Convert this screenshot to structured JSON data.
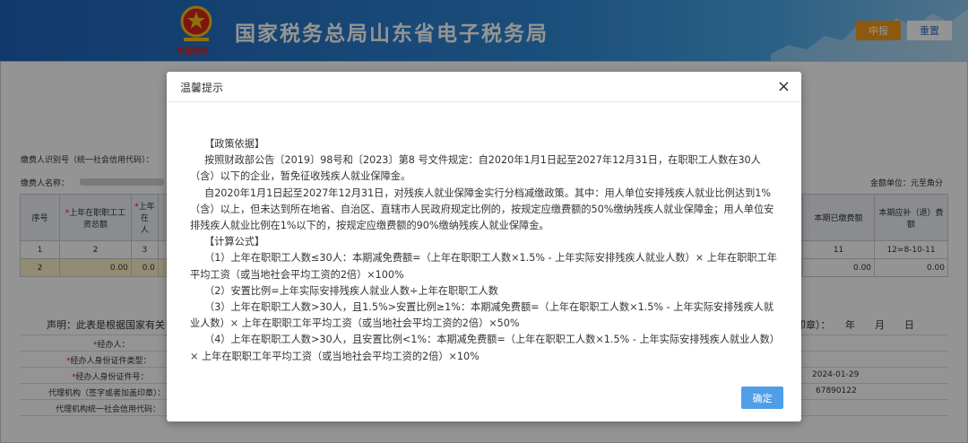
{
  "header": {
    "title": "国家税务总局山东省电子税务局",
    "logo_text": "中国税务",
    "declare_label": "申报",
    "reset_label": "重置"
  },
  "form": {
    "taxpayer_id_label": "缴费人识别号（统一社会信用代码）：",
    "taxpayer_name_label": "缴费人名称：",
    "unit_label": "金额单位：元至角分",
    "col_seq": "序号",
    "col_1": "上年在职职工工资总额",
    "col_2": "上年在",
    "col_2b": "人",
    "col_paid": "本期已缴费额",
    "col_due": "本期应补（退）费额",
    "row1": [
      "1",
      "2",
      "3",
      "11",
      "12=8-10-11"
    ],
    "row2_seq": "2",
    "row2_vals": [
      "0.00",
      "0.0",
      "0.00",
      "0.00"
    ],
    "statement": "声明：此表是根据国家有关",
    "stamp_date": "印章）：　　年　　月　　日",
    "agent_label": "经办人：",
    "agent_id_type_label": "经办人身份证件类型：",
    "agent_id_no_label": "经办人身份证件号：",
    "agency_label": "代理机构（签字或者加盖印章）：",
    "agency_code_label": "代理机构统一社会信用代码：",
    "date_value": "2024-01-29",
    "code_value": "67890122"
  },
  "dialog": {
    "title": "温馨提示",
    "close_symbol": "×",
    "paragraphs": [
      "【政策依据】",
      "按照财政部公告〔2019〕98号和〔2023〕第8 号文件规定：自2020年1月1日起至2027年12月31日，在职职工人数在30人（含）以下的企业，暂免征收残疾人就业保障金。",
      "自2020年1月1日起至2027年12月31日，对残疾人就业保障金实行分档减缴政策。其中：用人单位安排残疾人就业比例达到1%（含）以上，但未达到所在地省、自治区、直辖市人民政府规定比例的，按规定应缴费额的50%缴纳残疾人就业保障金；用人单位安排残疾人就业比例在1%以下的，按规定应缴费额的90%缴纳残疾人就业保障金。",
      "【计算公式】",
      "（1）上年在职职工人数≤30人：本期减免费额=（上年在职职工人数×1.5% - 上年实际安排残疾人就业人数）× 上年在职职工年平均工资（或当地社会平均工资的2倍）×100%",
      "（2）安置比例=上年实际安排残疾人就业人数÷上年在职职工人数",
      "（3）上年在职职工人数>30人，且1.5%>安置比例≥1%：本期减免费额=（上年在职职工人数×1.5% - 上年实际安排残疾人就业人数）× 上年在职职工年平均工资（或当地社会平均工资的2倍）×50%",
      "（4）上年在职职工人数>30人，且安置比例<1%：本期减免费额=（上年在职职工人数×1.5% - 上年实际安排残疾人就业人数）× 上年在职职工年平均工资（或当地社会平均工资的2倍）×10%"
    ],
    "ok_label": "确定"
  },
  "colors": {
    "header_blue": "#2e86d4",
    "declare_orange": "#f39a1e",
    "ok_blue": "#4f9ee8"
  }
}
